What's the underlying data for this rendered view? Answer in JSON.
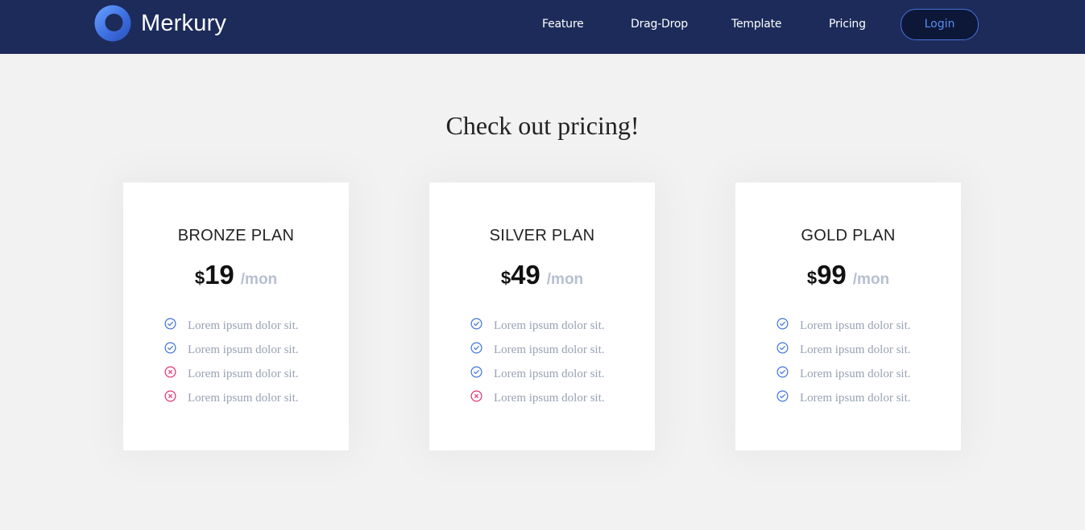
{
  "brand": {
    "name": "Merkury",
    "logo_icon": "ring-logo-icon"
  },
  "nav": {
    "links": [
      {
        "label": "Feature"
      },
      {
        "label": "Drag-Drop"
      },
      {
        "label": "Template"
      },
      {
        "label": "Pricing"
      }
    ],
    "login_label": "Login"
  },
  "pricing": {
    "title": "Check out pricing!",
    "plans": [
      {
        "name": "BRONZE PLAN",
        "currency": "$",
        "price": "19",
        "period": "/mon",
        "features": [
          {
            "text": "Lorem ipsum dolor sit.",
            "included": true,
            "icon": "check-circle-icon"
          },
          {
            "text": "Lorem ipsum dolor sit.",
            "included": true,
            "icon": "check-circle-icon"
          },
          {
            "text": "Lorem ipsum dolor sit.",
            "included": false,
            "icon": "x-circle-icon"
          },
          {
            "text": "Lorem ipsum dolor sit.",
            "included": false,
            "icon": "x-circle-icon"
          }
        ]
      },
      {
        "name": "SILVER PLAN",
        "currency": "$",
        "price": "49",
        "period": "/mon",
        "features": [
          {
            "text": "Lorem ipsum dolor sit.",
            "included": true,
            "icon": "check-circle-icon"
          },
          {
            "text": "Lorem ipsum dolor sit.",
            "included": true,
            "icon": "check-circle-icon"
          },
          {
            "text": "Lorem ipsum dolor sit.",
            "included": true,
            "icon": "check-circle-icon"
          },
          {
            "text": "Lorem ipsum dolor sit.",
            "included": false,
            "icon": "x-circle-icon"
          }
        ]
      },
      {
        "name": "GOLD PLAN",
        "currency": "$",
        "price": "99",
        "period": "/mon",
        "features": [
          {
            "text": "Lorem ipsum dolor sit.",
            "included": true,
            "icon": "check-circle-icon"
          },
          {
            "text": "Lorem ipsum dolor sit.",
            "included": true,
            "icon": "check-circle-icon"
          },
          {
            "text": "Lorem ipsum dolor sit.",
            "included": true,
            "icon": "check-circle-icon"
          },
          {
            "text": "Lorem ipsum dolor sit.",
            "included": true,
            "icon": "check-circle-icon"
          }
        ]
      }
    ]
  },
  "colors": {
    "header_bg": "#1c2b5a",
    "page_bg": "#f2f2f2",
    "check": "#3f73db",
    "cross": "#e6306f",
    "login_text": "#5b8cf2",
    "muted_text": "#98a2b4"
  }
}
